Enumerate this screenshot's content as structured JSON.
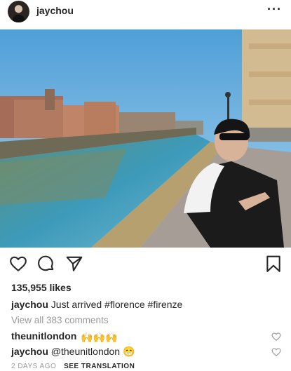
{
  "post": {
    "username": "jaychou",
    "more_label": "···",
    "likes": "135,955 likes",
    "caption": {
      "username": "jaychou",
      "text": "Just arrived #florence #firenze"
    },
    "view_comments": "View all 383 comments",
    "comments": [
      {
        "username": "theunitlondon",
        "text": "🙌🙌🙌"
      },
      {
        "username": "jaychou",
        "text": "@theunitlondon 😁"
      }
    ],
    "timestamp": "2 DAYS AGO",
    "see_translation": "SEE TRANSLATION"
  },
  "icons": {
    "avatar": "avatar",
    "more": "more-options-icon",
    "like": "heart-icon",
    "comment": "comment-bubble-icon",
    "share": "paper-plane-icon",
    "save": "bookmark-icon",
    "comment_like": "heart-icon"
  },
  "colors": {
    "text": "#262626",
    "secondary": "#999999",
    "background": "#ffffff"
  }
}
